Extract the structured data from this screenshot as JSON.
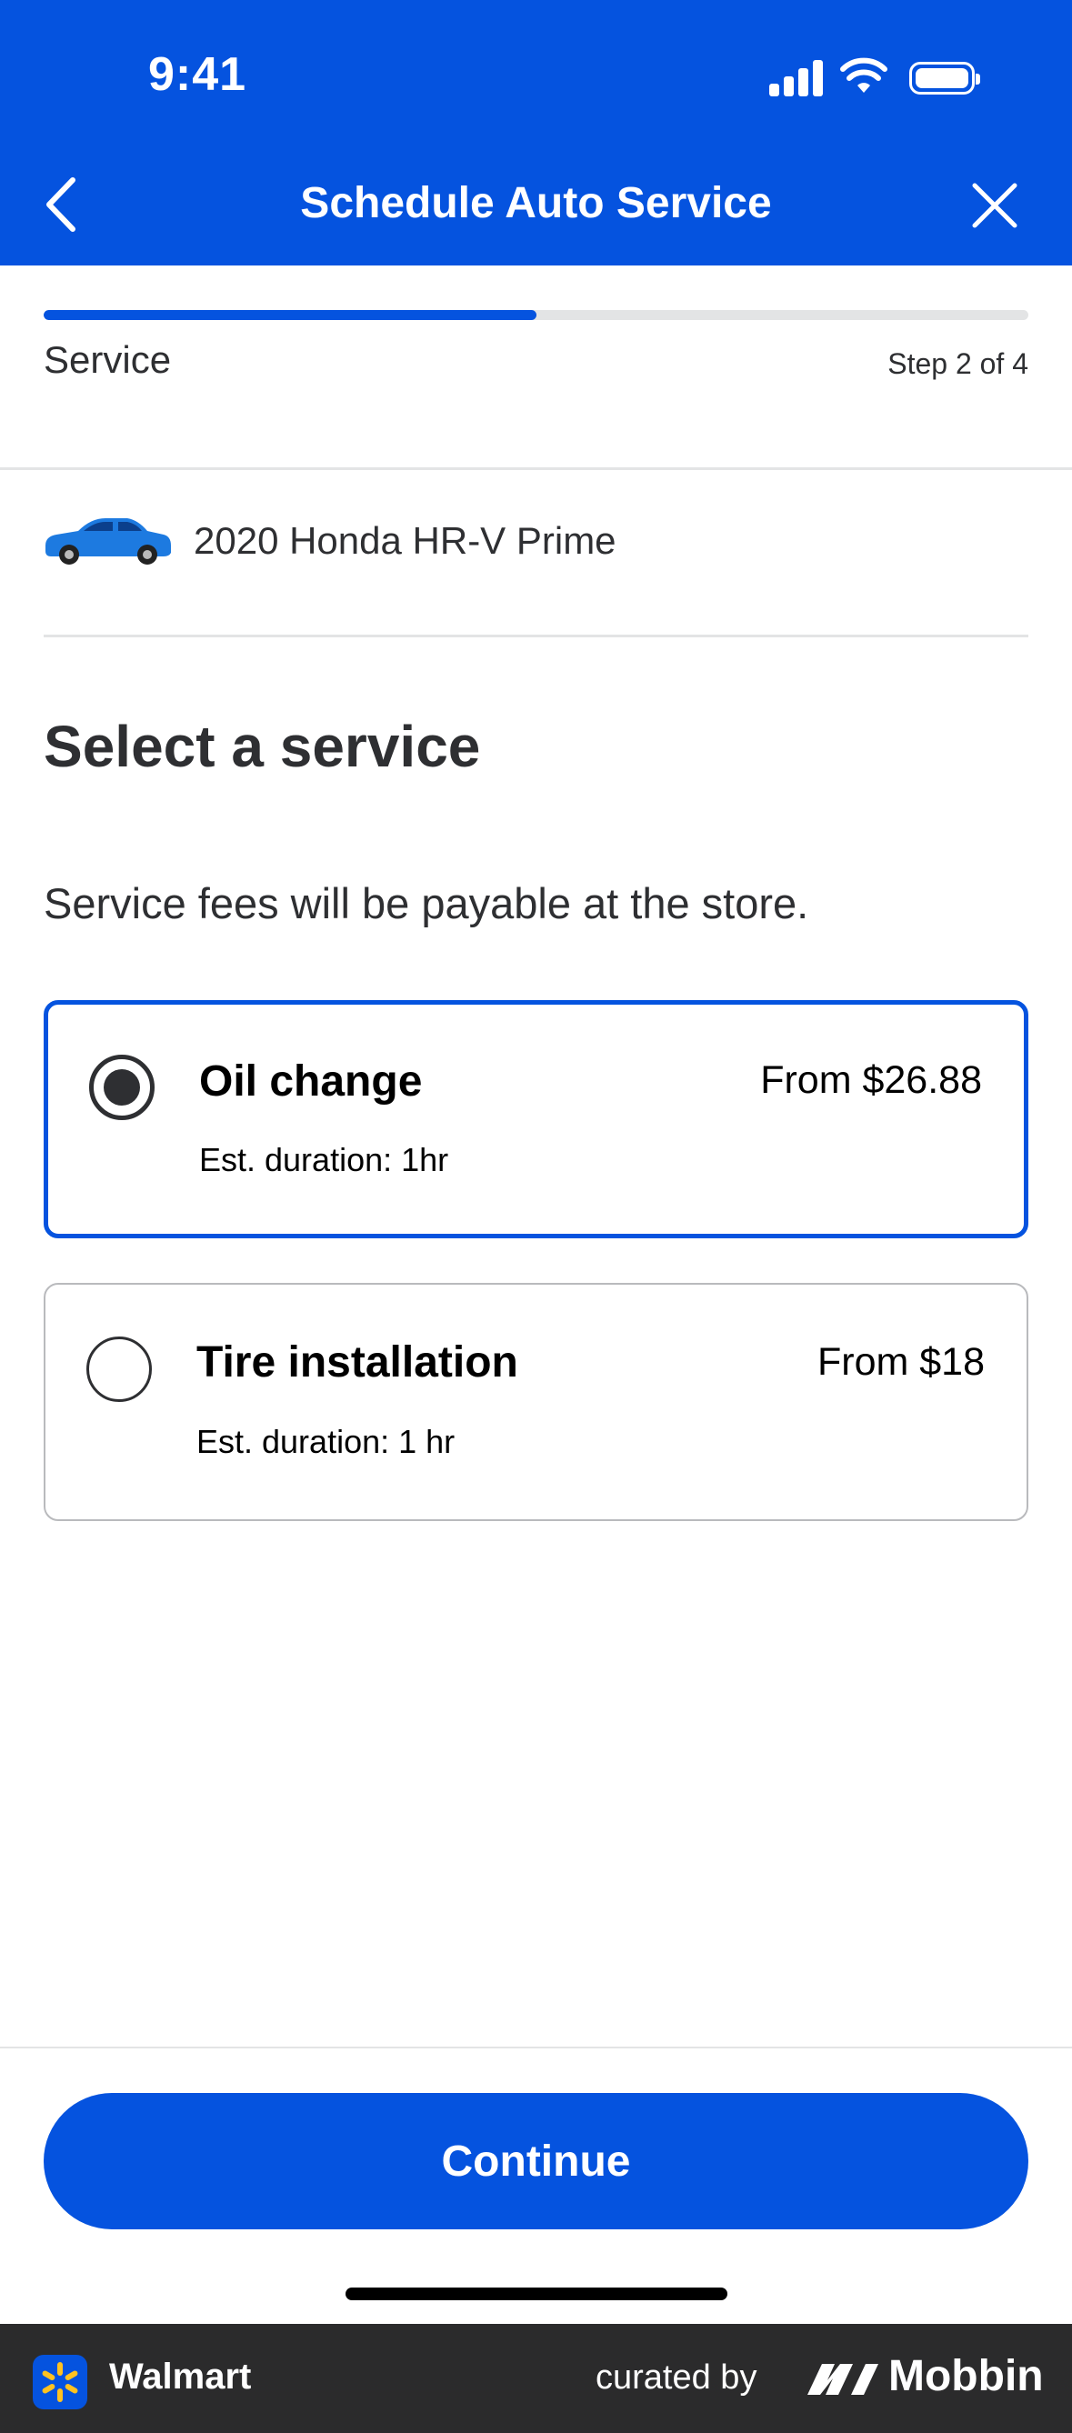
{
  "status_bar": {
    "time": "9:41"
  },
  "header": {
    "title": "Schedule Auto Service"
  },
  "progress": {
    "label": "Service",
    "step": "Step 2 of 4",
    "fraction": 0.5
  },
  "vehicle": {
    "name": "2020 Honda HR-V Prime"
  },
  "section": {
    "title": "Select a service",
    "note": "Service fees will be payable at the store."
  },
  "services": [
    {
      "name": "Oil change",
      "price": "From $26.88",
      "duration": "Est. duration: 1hr",
      "selected": true
    },
    {
      "name": "Tire installation",
      "price": "From $18",
      "duration": "Est. duration: 1 hr",
      "selected": false
    }
  ],
  "actions": {
    "continue_label": "Continue"
  },
  "footer": {
    "brand": "Walmart",
    "curated": "curated by",
    "mobbin": "Mobbin"
  },
  "colors": {
    "brand_blue": "#0553df",
    "text": "#2e2f32",
    "footer_bg": "#2b2b2c",
    "spark_yellow": "#ffc220"
  }
}
